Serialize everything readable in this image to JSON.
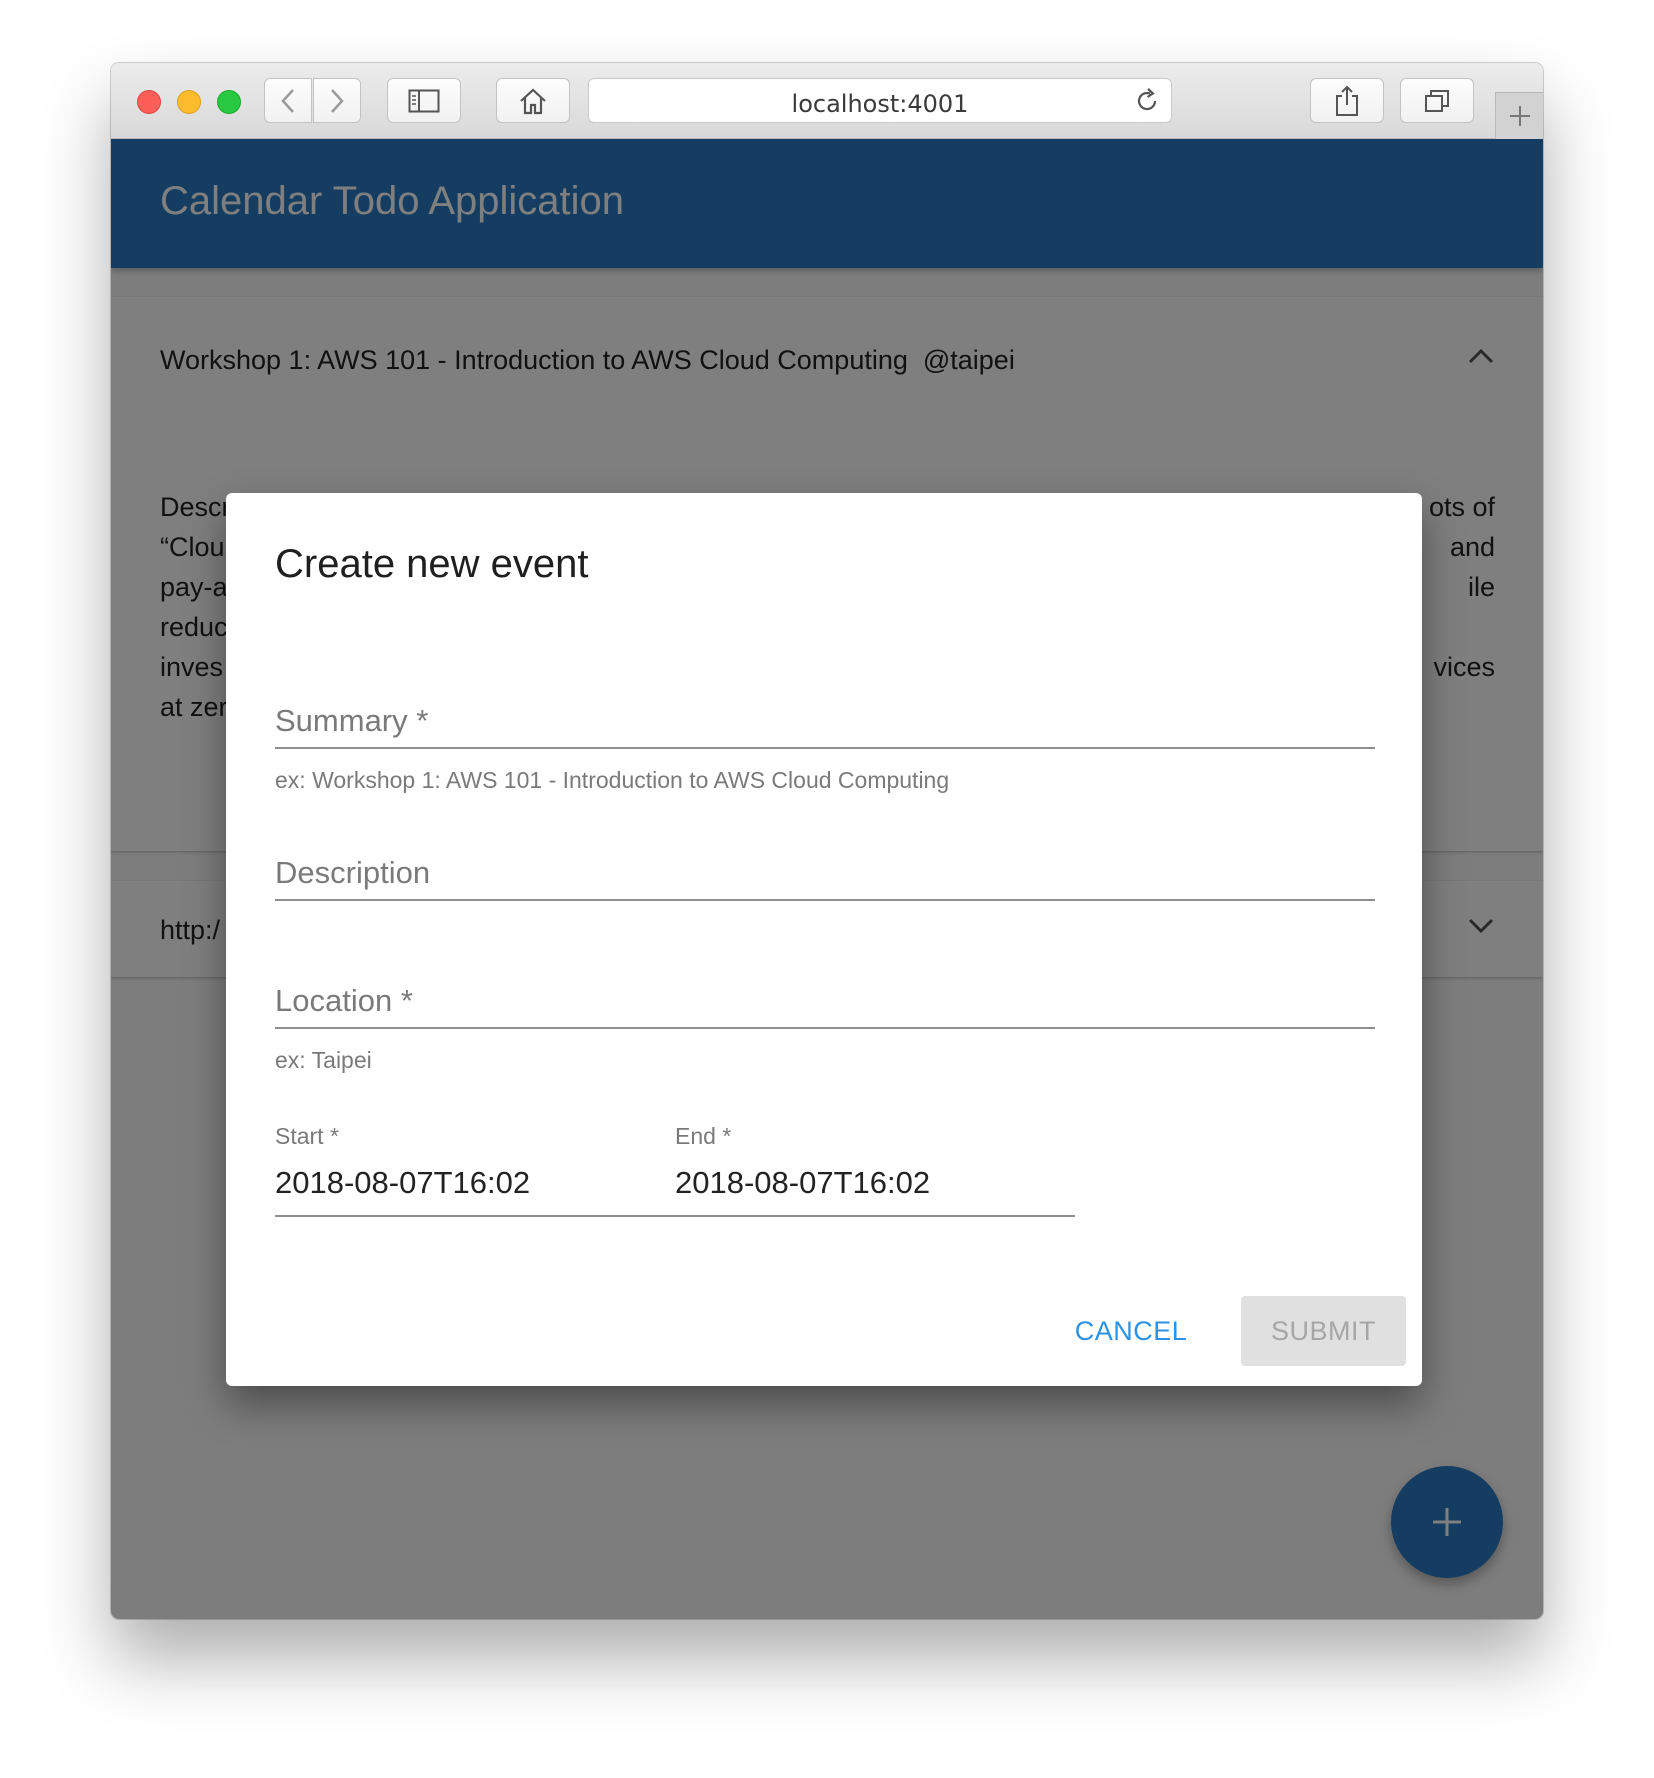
{
  "browser": {
    "url": "localhost:4001"
  },
  "app": {
    "title": "Calendar Todo Application"
  },
  "events": [
    {
      "title": "Workshop 1: AWS 101 - Introduction to AWS Cloud Computing  @taipei",
      "expanded": true,
      "description_left": [
        "Descr",
        "“Clou",
        "pay-a",
        "reduc",
        "inves",
        "at zer"
      ],
      "description_right": [
        "ots of",
        "and",
        "ile",
        "",
        "vices",
        ""
      ]
    },
    {
      "title": "http:/",
      "expanded": false
    }
  ],
  "dialog": {
    "title": "Create new event",
    "summary": {
      "label": "Summary *",
      "helper": "ex: Workshop 1: AWS 101 - Introduction to AWS Cloud Computing"
    },
    "description": {
      "label": "Description"
    },
    "location": {
      "label": "Location *",
      "helper": "ex: Taipei"
    },
    "start": {
      "label": "Start *",
      "value": "2018-08-07T16:02"
    },
    "end": {
      "label": "End *",
      "value": "2018-08-07T16:02"
    },
    "cancel_label": "CANCEL",
    "submit_label": "SUBMIT"
  },
  "colors": {
    "primary": "#2b7ac5",
    "accent_text": "#2b92e4",
    "overlay": "rgba(0,0,0,0.5)"
  },
  "icons": {
    "fab": "plus-icon",
    "panel1_toggle": "chevron-up-icon",
    "panel2_toggle": "chevron-down-icon"
  }
}
